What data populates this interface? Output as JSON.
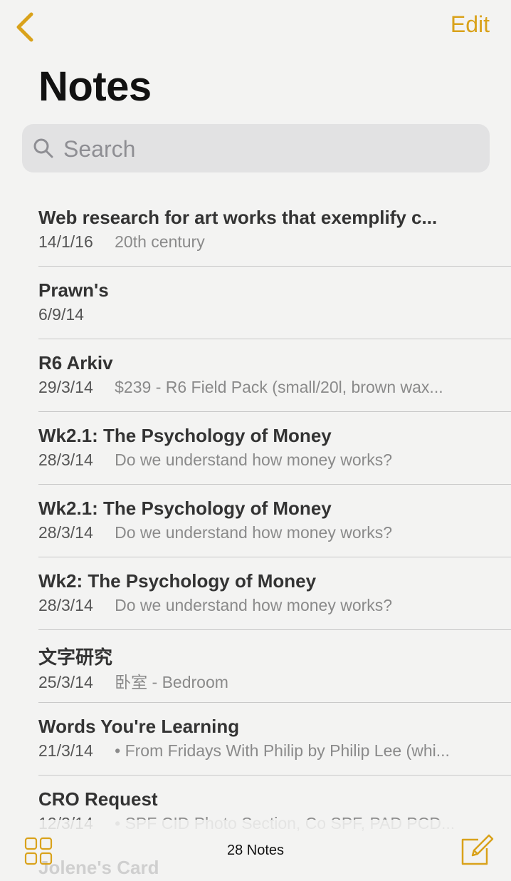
{
  "nav": {
    "back_icon": "chevron-left-icon",
    "edit_label": "Edit",
    "accent_color": "#d9a21b"
  },
  "page": {
    "title": "Notes"
  },
  "search": {
    "placeholder": "Search",
    "value": "",
    "icon": "search-icon"
  },
  "notes": [
    {
      "title": "Web research for art works that exemplify c...",
      "date": "14/1/16",
      "preview": "20th century"
    },
    {
      "title": "Prawn's",
      "date": "6/9/14",
      "preview": ""
    },
    {
      "title": "R6 Arkiv",
      "date": "29/3/14",
      "preview": "$239 - R6 Field Pack (small/20l, brown wax..."
    },
    {
      "title": "Wk2.1: The Psychology of Money",
      "date": "28/3/14",
      "preview": "Do we understand how money works?"
    },
    {
      "title": "Wk2.1: The Psychology of Money",
      "date": "28/3/14",
      "preview": "Do we understand how money works?"
    },
    {
      "title": "Wk2: The Psychology of Money",
      "date": "28/3/14",
      "preview": "Do we understand how money works?"
    },
    {
      "title": "文字研究",
      "date": "25/3/14",
      "preview": "卧室 - Bedroom"
    },
    {
      "title": "Words You're Learning",
      "date": "21/3/14",
      "preview": "• From Fridays With Philip by Philip Lee (whi..."
    },
    {
      "title": "CRO Request",
      "date": "12/3/14",
      "preview": "• SPF CID Photo Section, Co SPF, PAD PCD..."
    }
  ],
  "toolbar": {
    "gallery_icon": "grid-icon",
    "note_count": "28 Notes",
    "compose_icon": "compose-icon",
    "partially_hidden_title": "Jolene's Card"
  }
}
